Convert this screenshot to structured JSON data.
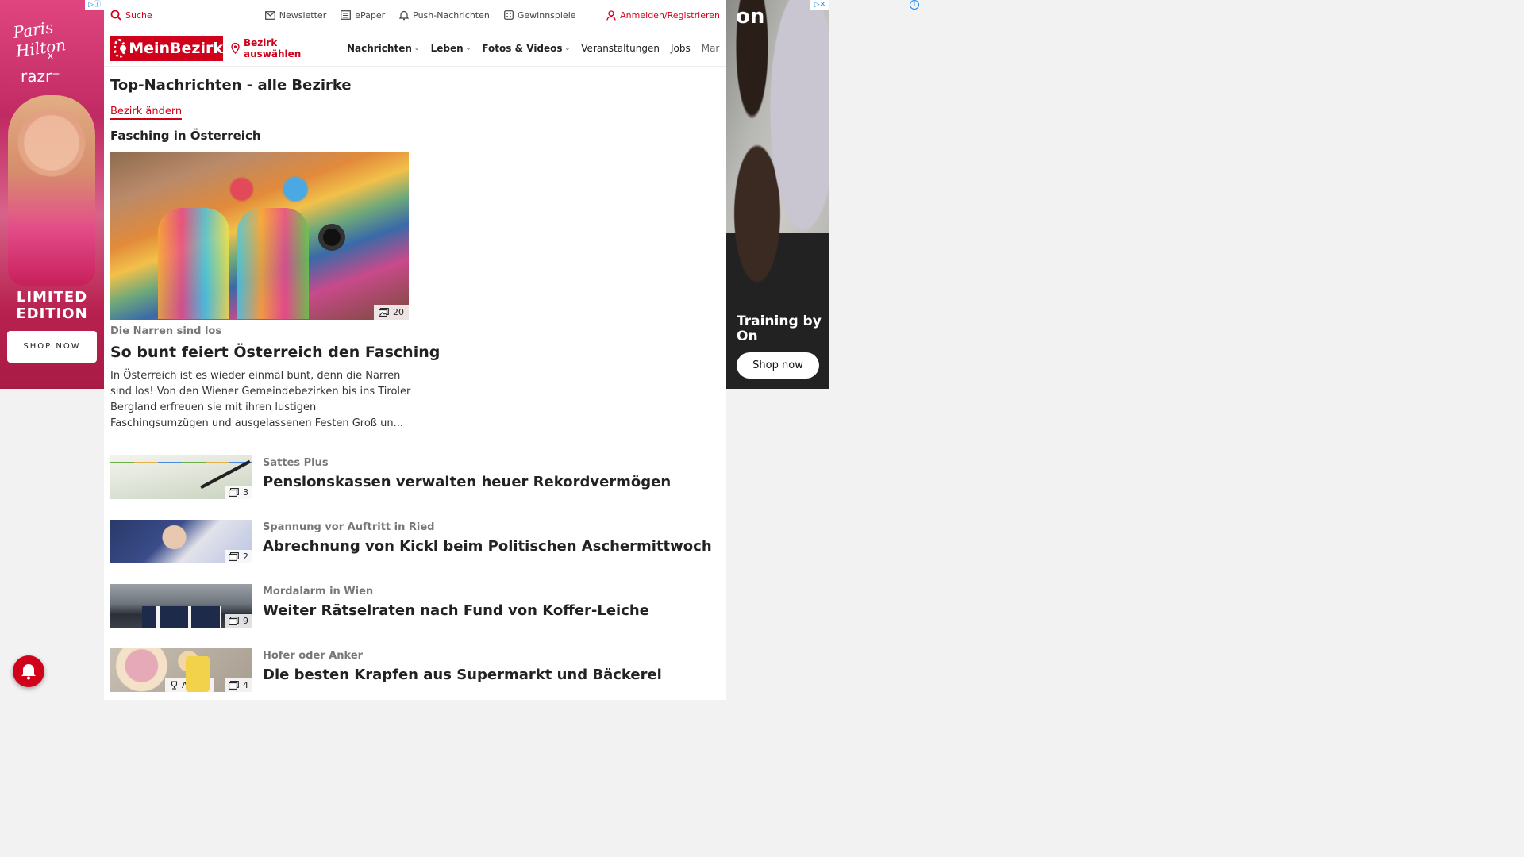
{
  "ads": {
    "left": {
      "brand_primary": "Paris Hilton",
      "brand_x": "x",
      "brand_secondary": "razr⁺",
      "tagline": "LIMITED EDITION",
      "cta": "SHOP NOW",
      "marker": "▷ⓘ"
    },
    "right": {
      "logo": "on",
      "tagline": "Training by On",
      "cta": "Shop now",
      "marker": "▷✕"
    },
    "info_marker": "i"
  },
  "topbar": {
    "search": "Suche",
    "newsletter": "Newsletter",
    "epaper": "ePaper",
    "push": "Push-Nachrichten",
    "gewinnspiele": "Gewinnspiele",
    "login": "Anmelden/Registrieren"
  },
  "navbar": {
    "logo": "MeinBezirk",
    "bezirk": "Bezirk auswählen",
    "items": [
      {
        "label": "Nachrichten"
      },
      {
        "label": "Leben"
      },
      {
        "label": "Fotos & Videos"
      },
      {
        "label": "Veranstaltungen"
      },
      {
        "label": "Jobs"
      },
      {
        "label": "Marktplatz"
      }
    ]
  },
  "page": {
    "title": "Top-Nachrichten - alle Bezirke",
    "change_district": "Bezirk ändern",
    "section": "Fasching in Österreich"
  },
  "hero": {
    "photo_count": "20",
    "kicker": "Die Narren sind los",
    "headline": "So bunt feiert Österreich den Fasching",
    "teaser": "In Österreich ist es wieder einmal bunt, denn die Narren sind los! Von den Wiener Gemeindebezirken bis ins Tiroler Bergland erfreuen sie mit ihren lustigen Faschingsumzügen und ausgelassenen Festen Groß un..."
  },
  "articles": [
    {
      "kicker": "Sattes Plus",
      "headline": "Pensionskassen verwalten heuer Rekordvermögen",
      "photo_count": "3"
    },
    {
      "kicker": "Spannung vor Auftritt in Ried",
      "headline": "Abrechnung von Kickl beim Politischen Aschermittwoch",
      "photo_count": "2"
    },
    {
      "kicker": "Mordalarm in Wien",
      "headline": "Weiter Rätselraten nach Fund von Koffer-Leiche",
      "photo_count": "9"
    },
    {
      "kicker": "Hofer oder Anker",
      "headline": "Die besten Krapfen aus Supermarkt und Bäckerei",
      "photo_count": "4",
      "badge": "Aktion"
    }
  ],
  "colors": {
    "brand": "#d0021b"
  }
}
